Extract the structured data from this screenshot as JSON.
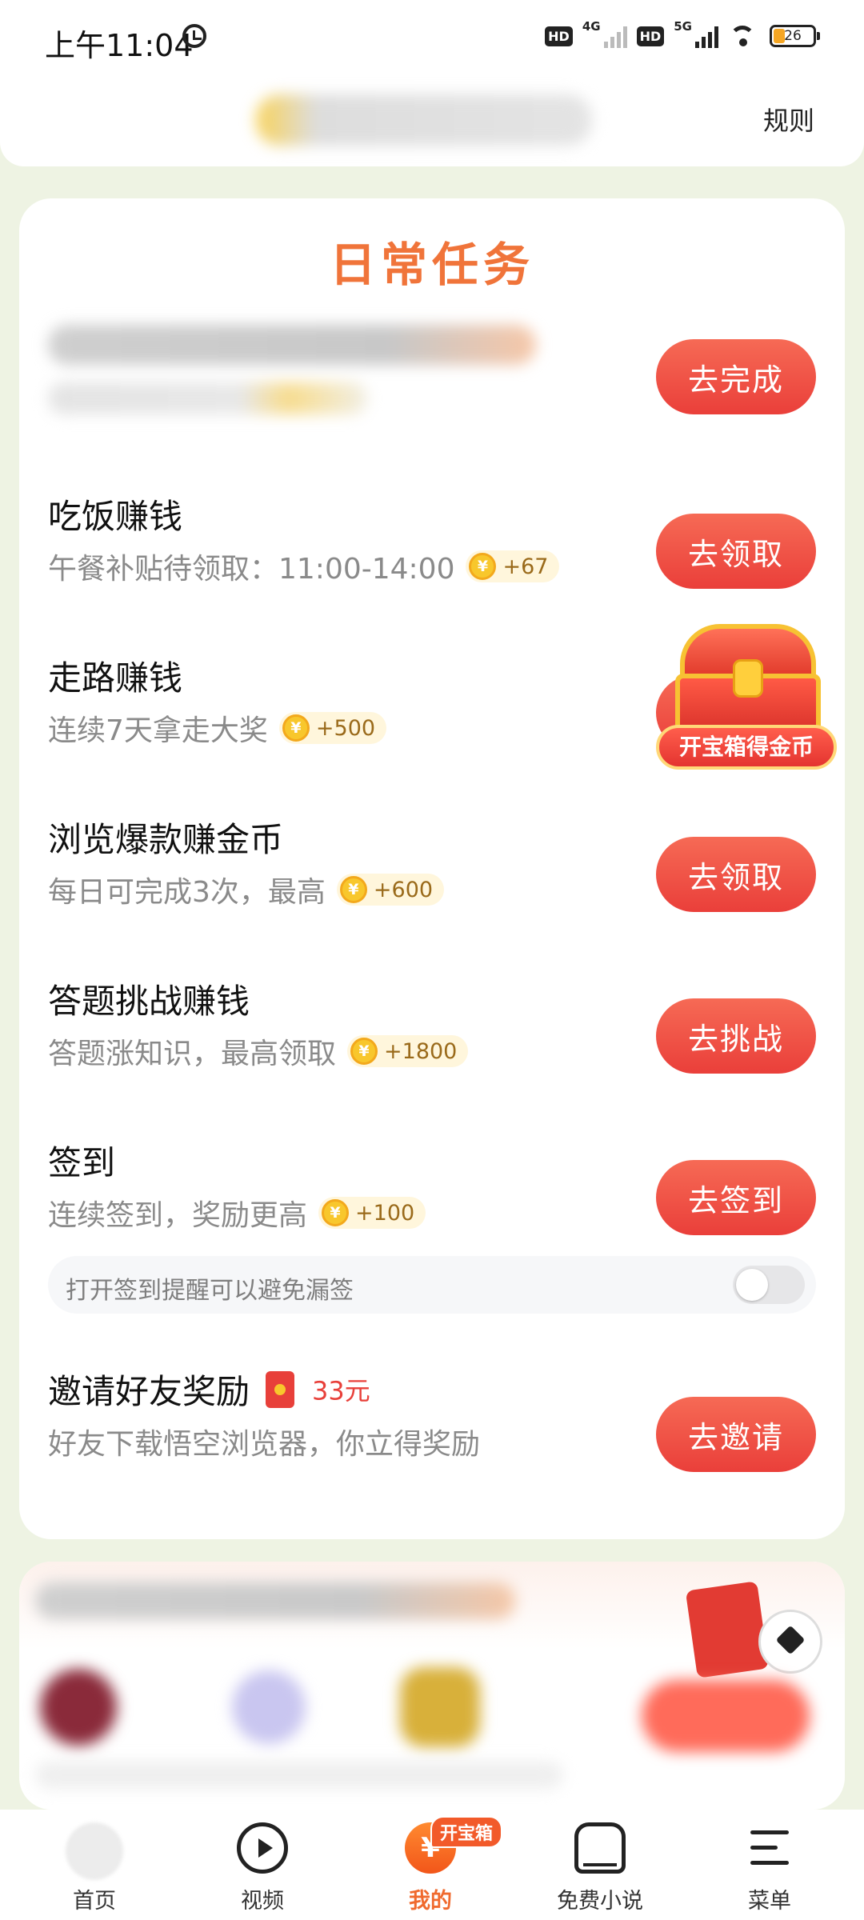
{
  "status_bar": {
    "time": "上午11:04",
    "network_1": "4G",
    "network_2": "5G",
    "hd_label": "HD",
    "battery": "26"
  },
  "header": {
    "rules_label": "规则"
  },
  "daily_tasks": {
    "title": "日常任务",
    "tasks": [
      {
        "title": "",
        "subtitle": "",
        "reward": "",
        "button": "去完成"
      },
      {
        "title": "吃饭赚钱",
        "subtitle": "午餐补贴待领取：11:00-14:00",
        "reward": "+67",
        "button": "去领取"
      },
      {
        "title": "走路赚钱",
        "subtitle": "连续7天拿走大奖",
        "reward": "+500",
        "button": ""
      },
      {
        "title": "浏览爆款赚金币",
        "subtitle": "每日可完成3次，最高",
        "reward": "+600",
        "button": "去领取"
      },
      {
        "title": "答题挑战赚钱",
        "subtitle": "答题涨知识，最高领取",
        "reward": "+1800",
        "button": "去挑战"
      },
      {
        "title": "签到",
        "subtitle": "连续签到，奖励更高",
        "reward": "+100",
        "button": "去签到"
      },
      {
        "title": "邀请好友奖励",
        "subtitle": "好友下载悟空浏览器，你立得奖励",
        "reward": "33元",
        "button": "去邀请"
      }
    ],
    "reminder_text": "打开签到提醒可以避免漏签",
    "reminder_enabled": false,
    "coin_symbol": "¥"
  },
  "treasure_chest": {
    "label": "开宝箱得金币"
  },
  "bottom_nav": {
    "items": [
      {
        "label": "首页",
        "icon": "home-icon"
      },
      {
        "label": "视频",
        "icon": "play-icon"
      },
      {
        "label": "我的",
        "icon": "yuan-coin-icon",
        "badge": "开宝箱",
        "symbol": "¥"
      },
      {
        "label": "免费小说",
        "icon": "book-icon"
      },
      {
        "label": "菜单",
        "icon": "menu-icon"
      }
    ],
    "active_index": 2
  },
  "colors": {
    "accent": "#f0743a",
    "button": "#ea3f3a",
    "page_bg": "#eef3e3",
    "coin": "#f8c72c"
  }
}
